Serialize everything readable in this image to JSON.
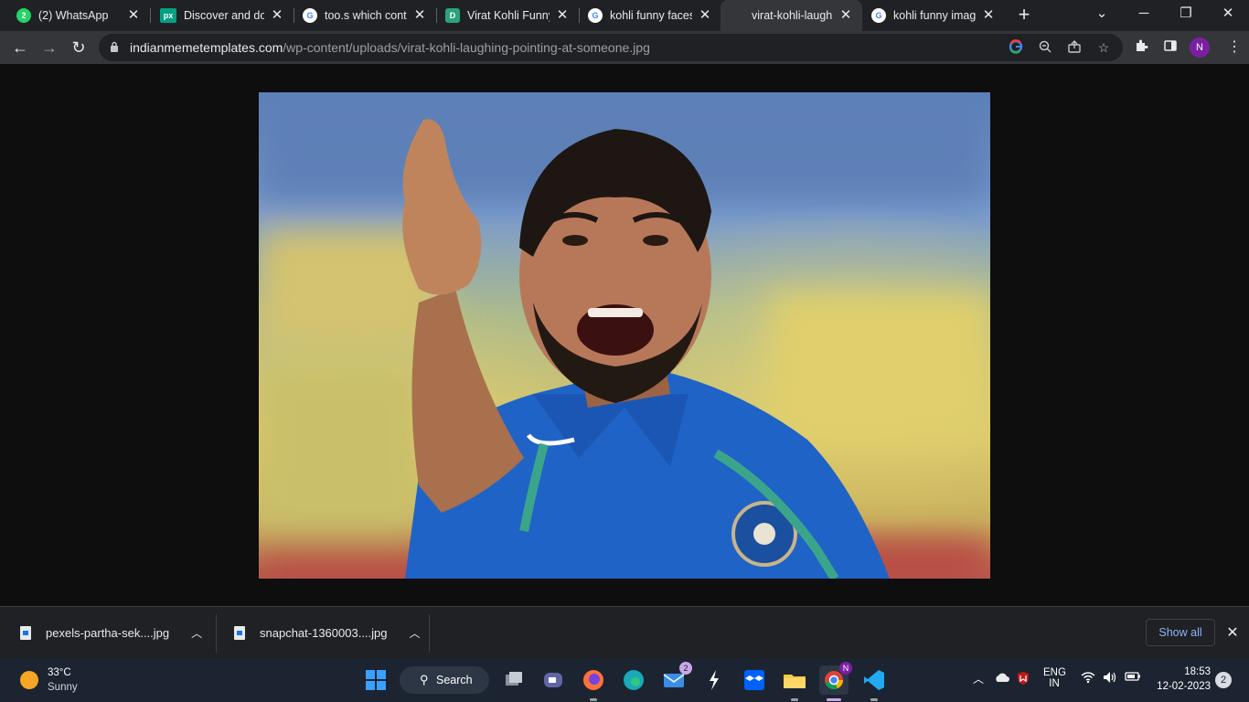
{
  "browser": {
    "tabs": [
      {
        "title": "(2) WhatsApp",
        "icon": "whatsapp-icon",
        "color": "#25d366",
        "glyph": "2",
        "active": false
      },
      {
        "title": "Discover and dow",
        "icon": "pexels-icon",
        "color": "#05a081",
        "glyph": "px",
        "active": false
      },
      {
        "title": "too.s which conta",
        "icon": "google-icon",
        "color": "#ffffff",
        "glyph": "G",
        "active": false
      },
      {
        "title": "Virat Kohli Funny",
        "icon": "site-icon",
        "color": "#2ba37c",
        "glyph": "D",
        "active": false
      },
      {
        "title": "kohli funny faces",
        "icon": "google-icon",
        "color": "#ffffff",
        "glyph": "G",
        "active": false
      },
      {
        "title": "virat-kohli-laughi",
        "icon": "",
        "color": "",
        "glyph": "",
        "active": true
      },
      {
        "title": "kohli funny image",
        "icon": "google-icon",
        "color": "#ffffff",
        "glyph": "G",
        "active": false
      }
    ],
    "new_tab_label": "+",
    "window_controls": {
      "tab_search": "⌄",
      "minimize": "─",
      "restore": "❐",
      "close": "✕"
    },
    "nav": {
      "back": "←",
      "forward": "→",
      "reload": "↻"
    },
    "url": {
      "host": "indianmemetemplates.com",
      "path": "/wp-content/uploads/virat-kohli-laughing-pointing-at-someone.jpg"
    },
    "omnibox_icons": [
      "google-icon",
      "zoom-out-icon",
      "share-icon",
      "star-icon"
    ],
    "profile_initial": "N"
  },
  "downloads": {
    "items": [
      {
        "name": "pexels-partha-sek....jpg"
      },
      {
        "name": "snapchat-1360003....jpg"
      }
    ],
    "show_all": "Show all",
    "close": "✕"
  },
  "taskbar": {
    "weather": {
      "temp": "33°C",
      "condition": "Sunny"
    },
    "search_label": "Search",
    "mail_badge": "2",
    "chrome_badge": "N",
    "tray": {
      "lang": "ENG",
      "region": "IN"
    },
    "clock": {
      "time": "18:53",
      "date": "12-02-2023"
    },
    "notifications": "2"
  },
  "colors": {
    "tab_strip": "#202124",
    "toolbar": "#35363a",
    "page_bg": "#0e0e0e",
    "taskbar": "#1c2431",
    "link": "#8ab4f8"
  }
}
